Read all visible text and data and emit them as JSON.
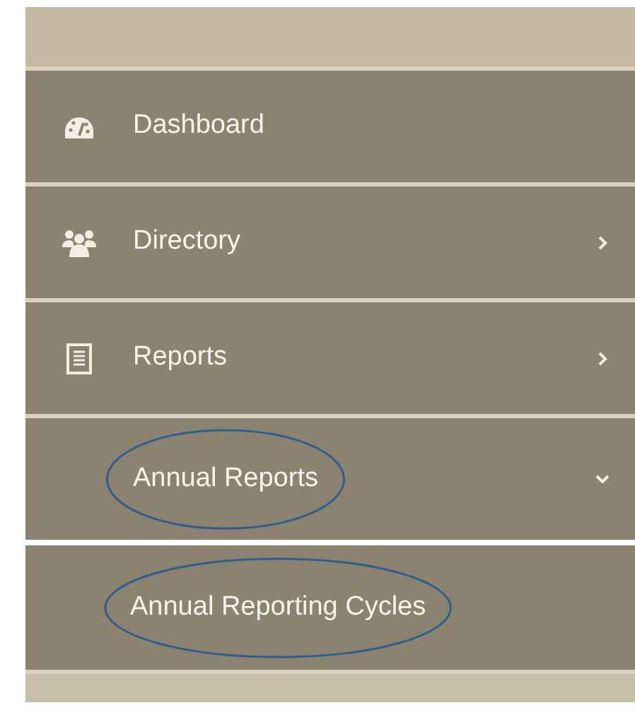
{
  "menu": [
    {
      "kind": "item",
      "label": "Dashboard",
      "circled": false
    },
    {
      "kind": "item",
      "label": "Directory",
      "expanded": false,
      "circled": false
    },
    {
      "kind": "item",
      "label": "Reports",
      "expanded": false,
      "circled": false
    },
    {
      "kind": "group",
      "label": "Annual Reports",
      "expanded": true,
      "circled": true
    },
    {
      "kind": "subitem",
      "label": "Annual Reporting Cycles",
      "circled": true
    }
  ]
}
